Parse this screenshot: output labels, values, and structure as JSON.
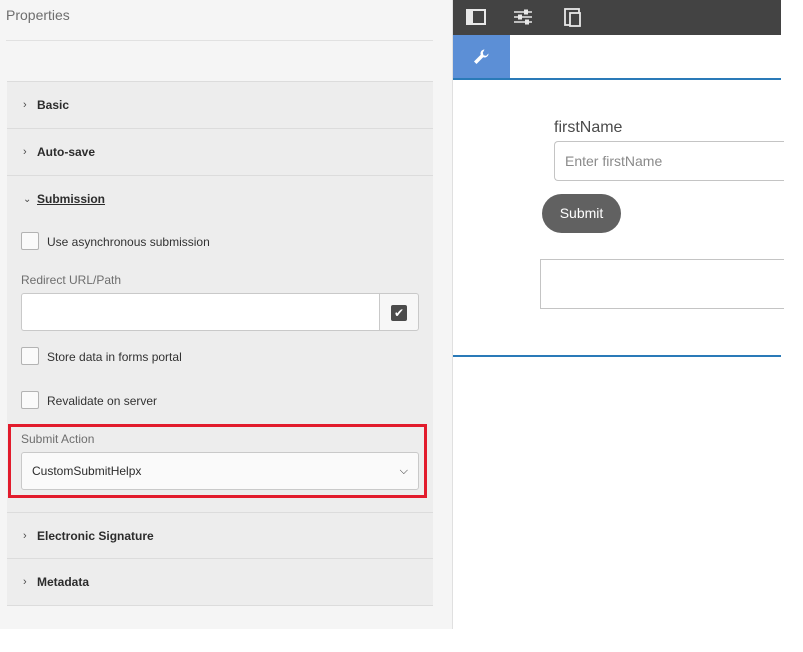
{
  "panel": {
    "title": "Properties",
    "sections": {
      "basic": "Basic",
      "autosave": "Auto-save",
      "submission": "Submission",
      "esign": "Electronic Signature",
      "metadata": "Metadata"
    },
    "submission": {
      "async_label": "Use asynchronous submission",
      "redirect_label": "Redirect URL/Path",
      "redirect_value": "",
      "store_label": "Store data in forms portal",
      "revalidate_label": "Revalidate on server",
      "submit_action_label": "Submit Action",
      "submit_action_value": "CustomSubmitHelpx"
    }
  },
  "editor": {
    "toolbar_icons": [
      "panel-toggle-icon",
      "properties-sliders-icon",
      "emulator-icon"
    ],
    "active_tab_icon": "wrench-icon",
    "form": {
      "field_label": "firstName",
      "field_placeholder": "Enter firstName",
      "submit_label": "Submit"
    }
  },
  "colors": {
    "highlight": "#e21b2c",
    "tab_active": "#5c8fd6",
    "toolbar": "#434343",
    "rule": "#2a7ab8"
  }
}
